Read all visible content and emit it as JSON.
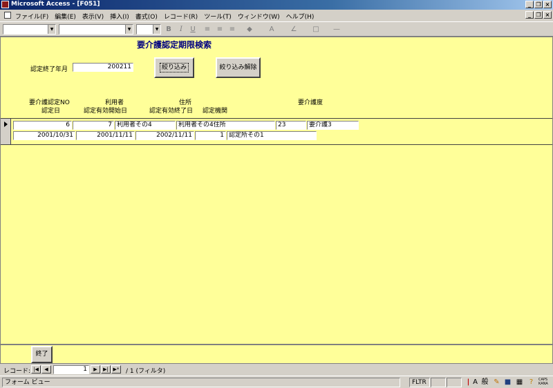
{
  "window": {
    "title": "Microsoft Access - [F051]",
    "min": "_",
    "restore": "❐",
    "close": "×"
  },
  "menu": [
    "ファイル(F)",
    "編集(E)",
    "表示(V)",
    "挿入(I)",
    "書式(O)",
    "レコード(R)",
    "ツール(T)",
    "ウィンドウ(W)",
    "ヘルプ(H)"
  ],
  "toolbar": {
    "bold": "B",
    "italic": "I",
    "underline": "U",
    "align_left": "≡",
    "align_center": "≡",
    "align_right": "≡",
    "fill_color": "◆",
    "font_color": "A",
    "line_color": "∠",
    "border": "□",
    "line_width": "—"
  },
  "form": {
    "title": "要介護認定期限検索",
    "filter_label": "認定終了年月",
    "filter_value": "200211",
    "filter_button": "絞り込み",
    "clear_button": "絞り込み解除",
    "headers": {
      "cert_no": "要介護認定NO",
      "user": "利用者",
      "address": "住所",
      "care_level": "要介護度",
      "cert_date": "認定日",
      "valid_start": "認定有効開始日",
      "valid_end": "認定有効終了日",
      "agency": "認定機関"
    },
    "record": {
      "cert_no": "6",
      "user_id": "7",
      "user_name": "利用者その4",
      "address": "利用者その4住所",
      "care_code": "23",
      "care_level": "要介護3",
      "cert_date": "2001/10/31",
      "valid_start": "2001/11/11",
      "valid_end": "2002/11/11",
      "agency_id": "1",
      "agency_name": "認定所その1"
    },
    "end_button": "終了"
  },
  "nav": {
    "label": "レコード:",
    "first": "|◀",
    "prev": "◀",
    "current": "1",
    "next": "▶",
    "last": "▶|",
    "new": "▶*",
    "total": "/ 1 (フィルタ)"
  },
  "status": {
    "view": "フォーム ビュー",
    "fltr": "FLTR",
    "ime_a": "A",
    "ime_mode": "般",
    "caps": "CAPS",
    "kana": "KANA"
  }
}
